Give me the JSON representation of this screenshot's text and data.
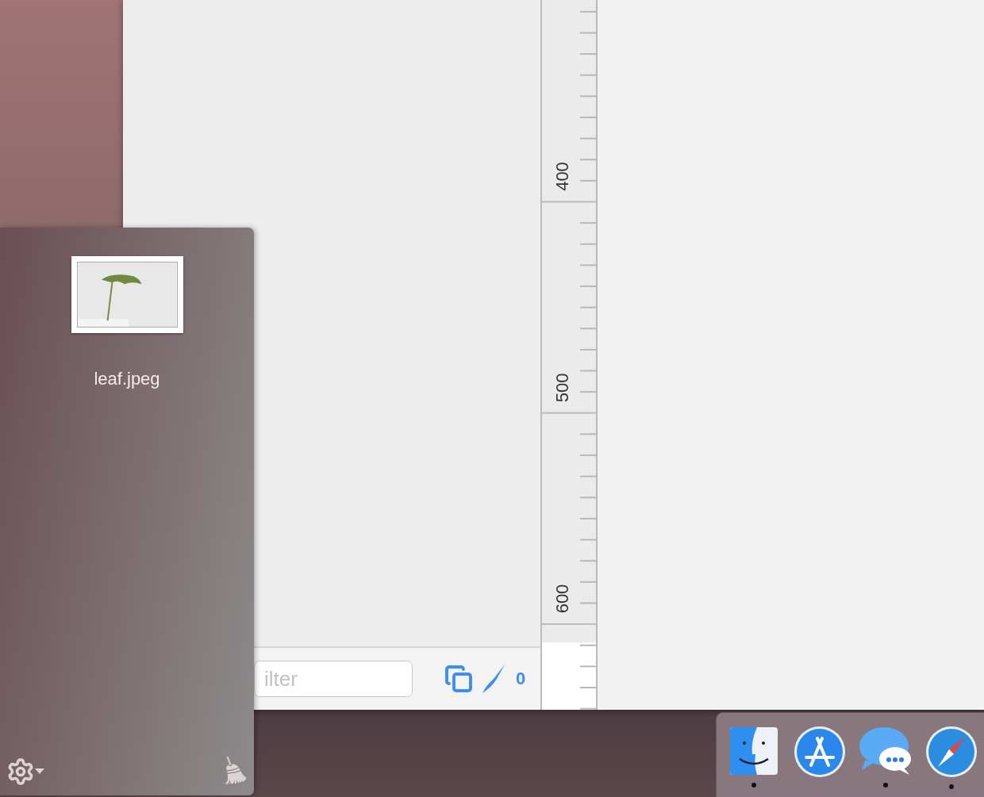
{
  "file_shelf": {
    "files": [
      {
        "name": "leaf.jpeg"
      }
    ]
  },
  "ruler": {
    "labels": [
      "400",
      "500",
      "600"
    ]
  },
  "bottom_bar": {
    "filter": {
      "placeholder": "ilter"
    },
    "count": "0"
  },
  "dock": {
    "apps": [
      {
        "kind": "finder",
        "running": true
      },
      {
        "kind": "appstore",
        "running": false
      },
      {
        "kind": "messages",
        "running": true
      },
      {
        "kind": "safari",
        "running": true
      }
    ]
  }
}
